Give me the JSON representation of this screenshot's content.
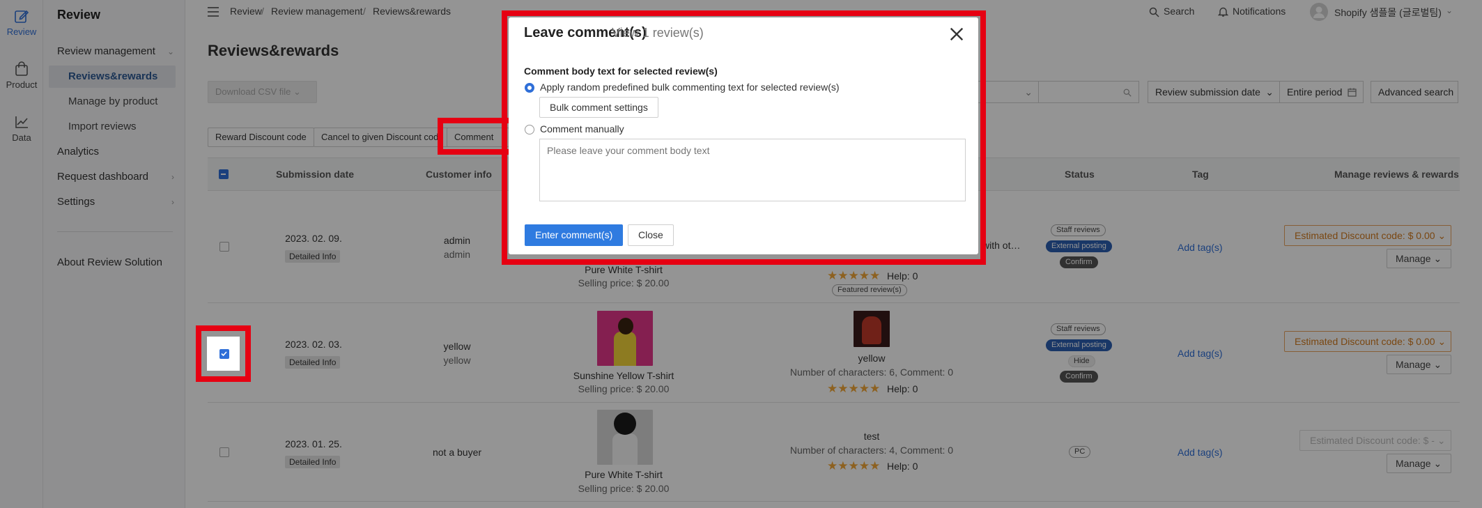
{
  "rail": {
    "items": [
      {
        "label": "Review",
        "icon": "edit-icon"
      },
      {
        "label": "Product",
        "icon": "bag-icon"
      },
      {
        "label": "Data",
        "icon": "chart-line-icon"
      }
    ]
  },
  "nav": {
    "title": "Review",
    "review_management": "Review management",
    "sub_items": [
      "Reviews&rewards",
      "Manage by product",
      "Import reviews"
    ],
    "analytics": "Analytics",
    "request_dashboard": "Request dashboard",
    "settings": "Settings",
    "about": "About Review Solution"
  },
  "topbar": {
    "breadcrumb": [
      "Review",
      "Review management",
      "Reviews&rewards"
    ],
    "separator": "/",
    "search": "Search",
    "notifications": "Notifications",
    "store": "Shopify 샘플몰 (글로벌팀)"
  },
  "page": {
    "title": "Reviews&rewards",
    "download_csv": "Download CSV file",
    "review_submission_date": "Review submission date",
    "entire_period": "Entire period",
    "advanced_search": "Advanced search",
    "actions": [
      "Reward Discount code",
      "Cancel to given Discount code",
      "Comment"
    ]
  },
  "table": {
    "headers": {
      "submission_date": "Submission date",
      "customer_info": "Customer info",
      "status": "Status",
      "tag": "Tag",
      "manage": "Manage reviews & rewards"
    },
    "detailed_info": "Detailed Info",
    "add_tag": "Add tag(s)",
    "manage": "Manage",
    "rows": [
      {
        "date": "2023. 02. 09.",
        "name": "admin",
        "handle": "admin",
        "product": "Pure White T-shirt",
        "price": "Selling price: $ 20.00",
        "review_snippet": "with ot…",
        "help": "Help: 0",
        "featured": "Featured review(s)",
        "badges": [
          "Staff reviews",
          "External posting",
          "Confirm"
        ],
        "estimate": "Estimated Discount code: $ 0.00",
        "checked": false
      },
      {
        "date": "2023. 02. 03.",
        "name": "yellow",
        "handle": "yellow",
        "product": "Sunshine Yellow T-shirt",
        "price": "Selling price: $ 20.00",
        "reviewer": "yellow",
        "chars": "Number of characters: 6, Comment: 0",
        "help": "Help: 0",
        "badges": [
          "Staff reviews",
          "External posting",
          "Hide",
          "Confirm"
        ],
        "estimate": "Estimated Discount code: $ 0.00",
        "checked": true
      },
      {
        "date": "2023. 01. 25.",
        "name": "not a buyer",
        "product": "Pure White T-shirt",
        "price": "Selling price: $ 20.00",
        "reviewer": "test",
        "chars": "Number of characters: 4, Comment: 0",
        "help": "Help: 0",
        "badges": [
          "PC"
        ],
        "estimate": "Estimated Discount code: $ -",
        "checked": false
      }
    ]
  },
  "modal": {
    "title": "Leave comment(s)",
    "subtitle": "View 1 review(s)",
    "label": "Comment body text for selected review(s)",
    "option_random": "Apply random predefined bulk commenting text for selected review(s)",
    "bulk_settings": "Bulk comment settings",
    "option_manual": "Comment manually",
    "placeholder": "Please leave your comment body text",
    "enter_button": "Enter comment(s)",
    "close_button": "Close"
  },
  "colors": {
    "accent": "#2f6fd8",
    "highlight": "#e60012",
    "discount": "#d27a1e"
  }
}
